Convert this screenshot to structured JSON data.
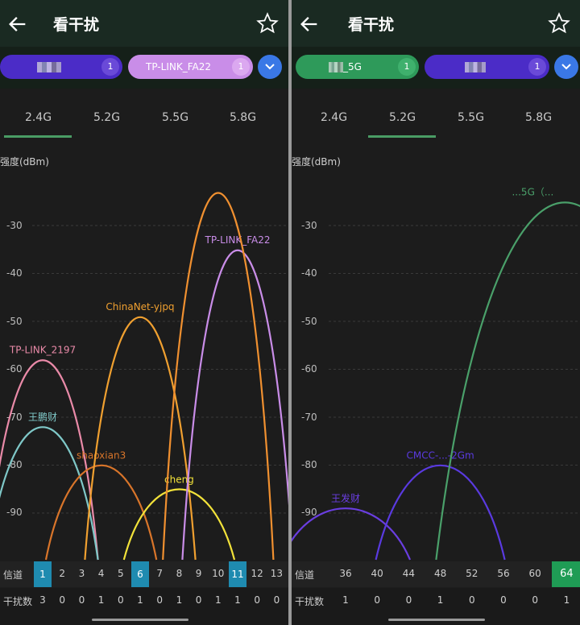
{
  "left": {
    "title": "看干扰",
    "chips": [
      {
        "label": "",
        "count": "1",
        "color": "#4b2cc7",
        "mosaic": true
      },
      {
        "label": "TP-LINK_FA22",
        "count": "1",
        "color": "#c98de8",
        "mosaic": false
      }
    ],
    "tabs": [
      "2.4G",
      "5.2G",
      "5.5G",
      "5.8G"
    ],
    "active_tab": 0,
    "y_axis_label": "强度(dBm)",
    "y_ticks": [
      "-30",
      "-40",
      "-50",
      "-60",
      "-70",
      "-80",
      "-90"
    ],
    "row_channel_label": "信道",
    "row_interf_label": "干扰数",
    "channels": [
      "1",
      "2",
      "3",
      "4",
      "5",
      "6",
      "7",
      "8",
      "9",
      "10",
      "11",
      "12",
      "13"
    ],
    "interference": [
      "3",
      "0",
      "0",
      "1",
      "0",
      "1",
      "0",
      "1",
      "0",
      "1",
      "1",
      "0",
      "0"
    ],
    "highlighted_channels": [
      1,
      6,
      11
    ],
    "networks": [
      {
        "name": "TP-LINK_2197",
        "channel": 1,
        "dbm": -58,
        "color": "#e98aa8"
      },
      {
        "name": "王鹏财",
        "channel": 1,
        "dbm": -72,
        "color": "#7fc8c8"
      },
      {
        "name": "shaoxian3",
        "channel": 4,
        "dbm": -80,
        "color": "#d9752a"
      },
      {
        "name": "ChinaNet-yjpq",
        "channel": 6,
        "dbm": -49,
        "color": "#f0a030"
      },
      {
        "name": "cheng",
        "channel": 8,
        "dbm": -85,
        "color": "#f2e23a"
      },
      {
        "name": "TP-LINK_FA22",
        "channel": 11,
        "dbm": -35,
        "color": "#c98de8"
      },
      {
        "name": "",
        "channel": 10,
        "dbm": -23,
        "color": "#f09030"
      }
    ]
  },
  "right": {
    "title": "看干扰",
    "chips": [
      {
        "label": "_5G",
        "count": "1",
        "color": "#2e9a5a",
        "mosaic": true
      },
      {
        "label": "",
        "count": "1",
        "color": "#4b2cc7",
        "mosaic": true
      }
    ],
    "tabs": [
      "2.4G",
      "5.2G",
      "5.5G",
      "5.8G"
    ],
    "active_tab": 1,
    "y_axis_label": "强度(dBm)",
    "y_ticks": [
      "-30",
      "-40",
      "-50",
      "-60",
      "-70",
      "-80",
      "-90"
    ],
    "row_channel_label": "信道",
    "row_interf_label": "干扰数",
    "channels": [
      "36",
      "40",
      "44",
      "48",
      "52",
      "56",
      "60",
      "64"
    ],
    "interference": [
      "1",
      "0",
      "0",
      "1",
      "0",
      "0",
      "0",
      "1"
    ],
    "highlighted_channels": [
      64
    ],
    "networks": [
      {
        "name": "王发财",
        "channel": 36,
        "dbm": -89,
        "color": "#6a3ee0"
      },
      {
        "name": "CMCC-...-2Gm",
        "channel": 48,
        "dbm": -80,
        "color": "#5a3ae0"
      },
      {
        "name": "...5G（...",
        "channel": 64,
        "dbm": -25,
        "color": "#4aa06a"
      }
    ]
  },
  "chart_data": [
    {
      "type": "area",
      "title": "看干扰 2.4G",
      "xlabel": "信道",
      "ylabel": "强度(dBm)",
      "x": [
        1,
        2,
        3,
        4,
        5,
        6,
        7,
        8,
        9,
        10,
        11,
        12,
        13
      ],
      "series": [
        {
          "name": "TP-LINK_2197",
          "channel": 1,
          "dbm": -58
        },
        {
          "name": "王鹏财",
          "channel": 1,
          "dbm": -72
        },
        {
          "name": "shaoxian3",
          "channel": 4,
          "dbm": -80
        },
        {
          "name": "ChinaNet-yjpq",
          "channel": 6,
          "dbm": -49
        },
        {
          "name": "cheng",
          "channel": 8,
          "dbm": -85
        },
        {
          "name": "TP-LINK_FA22",
          "channel": 11,
          "dbm": -35
        }
      ],
      "ylim": [
        -98,
        -20
      ]
    },
    {
      "type": "area",
      "title": "看干扰 5.2G",
      "xlabel": "信道",
      "ylabel": "强度(dBm)",
      "x": [
        36,
        40,
        44,
        48,
        52,
        56,
        60,
        64
      ],
      "series": [
        {
          "name": "王发财",
          "channel": 36,
          "dbm": -89
        },
        {
          "name": "CMCC-2Gm",
          "channel": 48,
          "dbm": -80
        },
        {
          "name": "5G",
          "channel": 64,
          "dbm": -25
        }
      ],
      "ylim": [
        -98,
        -20
      ]
    }
  ]
}
